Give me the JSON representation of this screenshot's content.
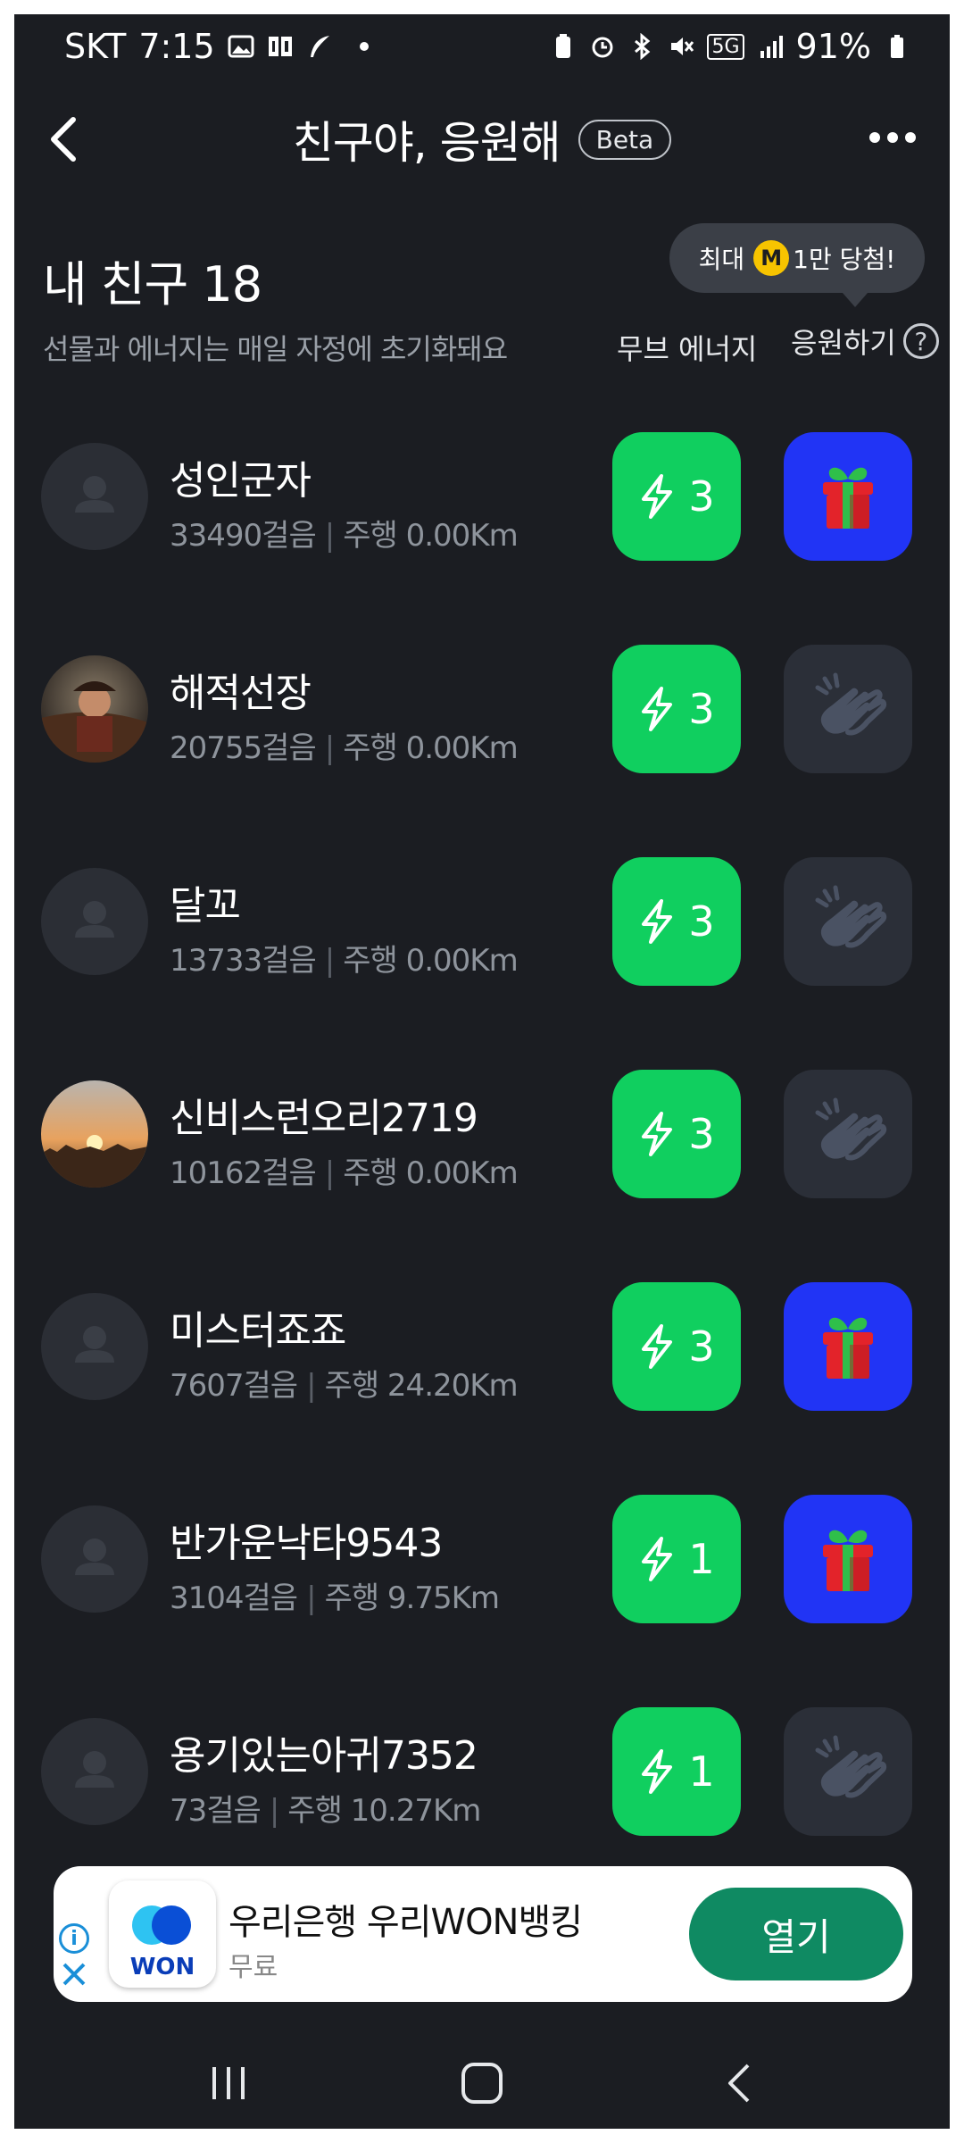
{
  "status_bar": {
    "carrier": "SKT",
    "time": "7:15",
    "network": "5G",
    "battery": "91%"
  },
  "header": {
    "title": "친구야, 응원해",
    "badge": "Beta"
  },
  "section": {
    "title": "내 친구 18",
    "subtitle": "선물과 에너지는 매일 자정에 초기화돼요",
    "col_energy": "무브 에너지",
    "col_cheer": "응원하기",
    "help": "?"
  },
  "tooltip": {
    "prefix": "최대",
    "coin": "M",
    "suffix": "1만 당첨!"
  },
  "friends": [
    {
      "name": "성인군자",
      "steps": "33490걸음",
      "drive": "주행 0.00Km",
      "energy": "3",
      "cheer": "gift",
      "avatar": "default"
    },
    {
      "name": "해적선장",
      "steps": "20755걸음",
      "drive": "주행 0.00Km",
      "energy": "3",
      "cheer": "clap",
      "avatar": "pirate"
    },
    {
      "name": "달꼬",
      "steps": "13733걸음",
      "drive": "주행 0.00Km",
      "energy": "3",
      "cheer": "clap",
      "avatar": "default"
    },
    {
      "name": "신비스런오리2719",
      "steps": "10162걸음",
      "drive": "주행 0.00Km",
      "energy": "3",
      "cheer": "clap",
      "avatar": "sunset"
    },
    {
      "name": "미스터죠죠",
      "steps": "7607걸음",
      "drive": "주행 24.20Km",
      "energy": "3",
      "cheer": "gift",
      "avatar": "default"
    },
    {
      "name": "반가운낙타9543",
      "steps": "3104걸음",
      "drive": "주행 9.75Km",
      "energy": "1",
      "cheer": "gift",
      "avatar": "default"
    },
    {
      "name": "용기있는아귀7352",
      "steps": "73걸음",
      "drive": "주행 10.27Km",
      "energy": "1",
      "cheer": "clap",
      "avatar": "default"
    }
  ],
  "ad": {
    "title": "우리은행 우리WON뱅킹",
    "subtitle": "무료",
    "open_label": "열기",
    "logo_text": "WON",
    "info": "i"
  },
  "colors": {
    "background": "#1b1d22",
    "energy": "#10cf5f",
    "gift": "#2134f5",
    "ad_button": "#0f8a62"
  }
}
